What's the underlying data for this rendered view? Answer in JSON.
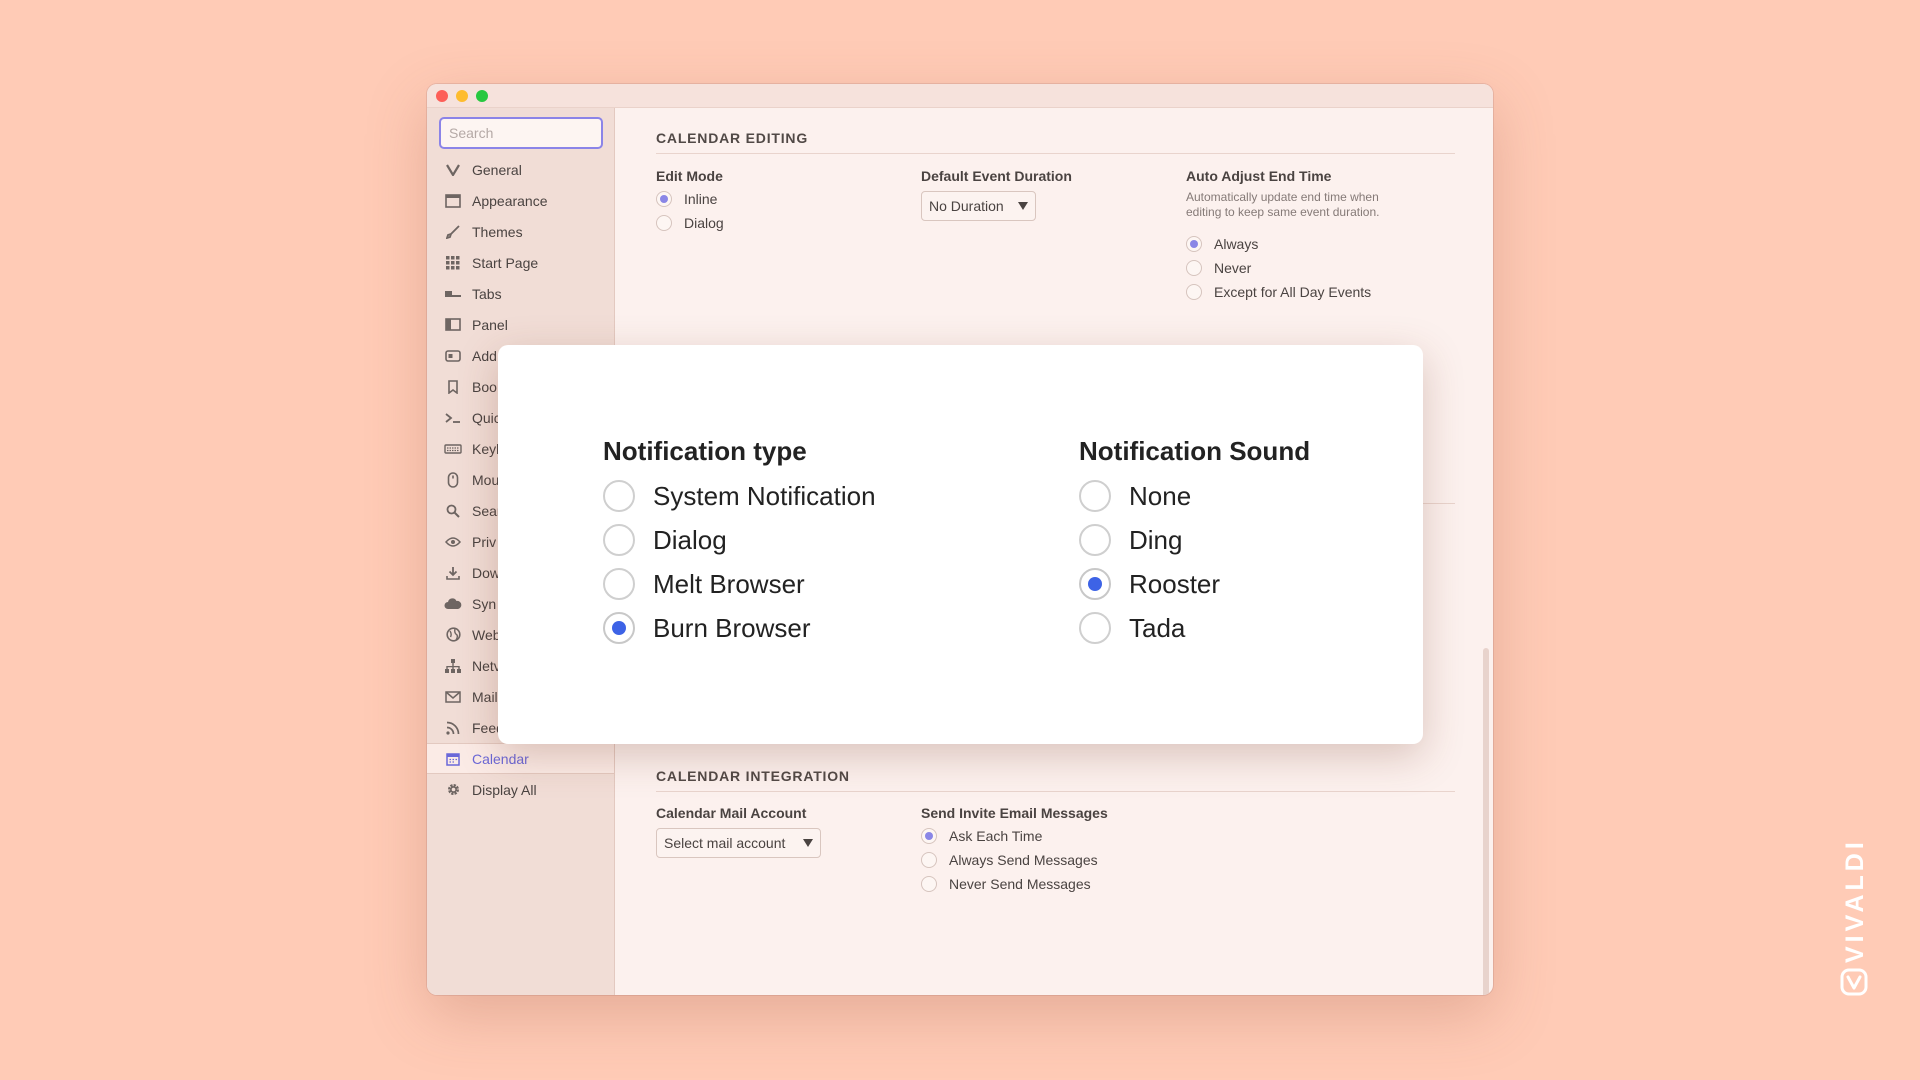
{
  "sidebar": {
    "search_placeholder": "Search",
    "items": [
      {
        "label": "General",
        "icon": "vivaldi-v-icon"
      },
      {
        "label": "Appearance",
        "icon": "window-icon"
      },
      {
        "label": "Themes",
        "icon": "brush-icon"
      },
      {
        "label": "Start Page",
        "icon": "grid-icon"
      },
      {
        "label": "Tabs",
        "icon": "tabs-icon"
      },
      {
        "label": "Panel",
        "icon": "panel-icon"
      },
      {
        "label": "Add",
        "icon": "address-bar-icon"
      },
      {
        "label": "Boo",
        "icon": "bookmark-icon"
      },
      {
        "label": "Quic",
        "icon": "quick-command-icon"
      },
      {
        "label": "Keyl",
        "icon": "keyboard-icon"
      },
      {
        "label": "Mou",
        "icon": "mouse-icon"
      },
      {
        "label": "Sear",
        "icon": "search-icon"
      },
      {
        "label": "Priv",
        "icon": "eye-icon"
      },
      {
        "label": "Dow",
        "icon": "download-icon"
      },
      {
        "label": "Syn",
        "icon": "cloud-icon"
      },
      {
        "label": "Web",
        "icon": "globe-icon"
      },
      {
        "label": "Netv",
        "icon": "network-icon"
      },
      {
        "label": "Mail",
        "icon": "mail-icon"
      },
      {
        "label": "Feed",
        "icon": "rss-icon"
      },
      {
        "label": "Calendar",
        "icon": "calendar-icon",
        "active": true
      },
      {
        "label": "Display All",
        "icon": "gear-icon"
      }
    ]
  },
  "calendar_editing": {
    "title": "CALENDAR EDITING",
    "edit_mode": {
      "label": "Edit Mode",
      "options": [
        "Inline",
        "Dialog"
      ],
      "selected": "Inline"
    },
    "default_duration": {
      "label": "Default Event Duration",
      "value": "No Duration"
    },
    "auto_adjust": {
      "label": "Auto Adjust End Time",
      "description": "Automatically update end time when editing to keep same event duration.",
      "options": [
        "Always",
        "Never",
        "Except for All Day Events"
      ],
      "selected": "Always"
    }
  },
  "calendar_integration": {
    "title": "CALENDAR INTEGRATION",
    "mail_account": {
      "label": "Calendar Mail Account",
      "value": "Select mail account"
    },
    "send_invite": {
      "label": "Send Invite Email Messages",
      "options": [
        "Ask Each Time",
        "Always Send Messages",
        "Never Send Messages"
      ],
      "selected": "Ask Each Time"
    }
  },
  "modal": {
    "notification_type": {
      "heading": "Notification type",
      "options": [
        "System Notification",
        "Dialog",
        "Melt Browser",
        "Burn Browser"
      ],
      "selected": "Burn Browser"
    },
    "notification_sound": {
      "heading": "Notification Sound",
      "options": [
        "None",
        "Ding",
        "Rooster",
        "Tada"
      ],
      "selected": "Rooster"
    }
  },
  "brand": {
    "text": "VIVALDI",
    "icon": "vivaldi-logo-icon"
  },
  "colors": {
    "background": "#ffcbb6",
    "accent": "#3d63e6",
    "sidebar_accent": "#6b68d8"
  }
}
